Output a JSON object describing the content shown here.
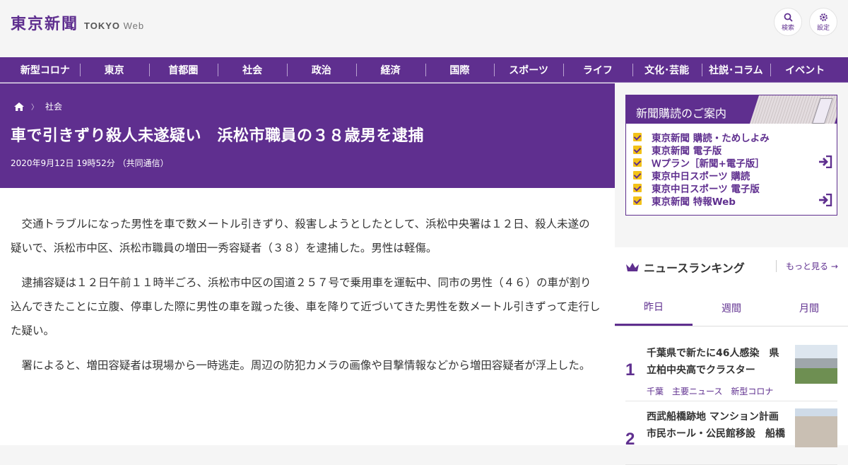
{
  "header": {
    "logo_jp": "東京新聞",
    "logo_en": "TOKYO",
    "logo_web": "Web",
    "search_label": "検索",
    "settings_label": "設定"
  },
  "nav": [
    "新型コロナ",
    "東京",
    "首都圏",
    "社会",
    "政治",
    "経済",
    "国際",
    "スポーツ",
    "ライフ",
    "文化･芸能",
    "社説･コラム",
    "イベント"
  ],
  "article": {
    "breadcrumb": "社会",
    "title": "車で引きずり殺人未遂疑い　浜松市職員の３８歳男を逮捕",
    "date": "2020年9月12日 19時52分 （共同通信）",
    "paragraphs": [
      "交通トラブルになった男性を車で数メートル引きずり、殺害しようとしたとして、浜松中央署は１２日、殺人未遂の疑いで、浜松市中区、浜松市職員の増田一秀容疑者（３８）を逮捕した。男性は軽傷。",
      "逮捕容疑は１２日午前１１時半ごろ、浜松市中区の国道２５７号で乗用車を運転中、同市の男性（４６）の車が割り込んできたことに立腹、停車した際に男性の車を蹴った後、車を降りて近づいてきた男性を数メートル引きずって走行した疑い。",
      "署によると、増田容疑者は現場から一時逃走。周辺の防犯カメラの画像や目撃情報などから増田容疑者が浮上した。"
    ]
  },
  "subscription": {
    "title": "新聞購読のご案内",
    "items": [
      "東京新聞 購読・ためしよみ",
      "東京新聞 電子版",
      "Ｗプラン［新聞+電子版］",
      "東京中日スポーツ 購読",
      "東京中日スポーツ 電子版",
      "東京新聞 特報Web"
    ]
  },
  "ranking": {
    "title": "ニュースランキング",
    "more": "もっと見る",
    "tabs": [
      "昨日",
      "週間",
      "月間"
    ],
    "items": [
      {
        "num": "1",
        "title": "千葉県で新たに46人感染　県立柏中央高でクラスター",
        "tags": [
          "千葉",
          "主要ニュース",
          "新型コロナ"
        ]
      },
      {
        "num": "2",
        "title": "西武船橋跡地 マンション計画 市民ホール・公民館移設　船橋",
        "tags": []
      }
    ]
  },
  "colors": {
    "brand": "#5f2f8f",
    "check": "#f3c218"
  }
}
